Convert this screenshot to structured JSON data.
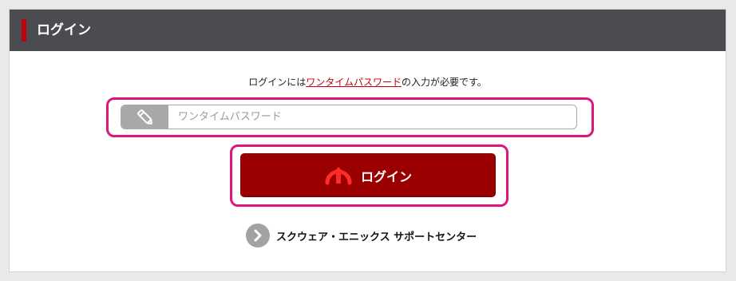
{
  "header": {
    "title": "ログイン"
  },
  "notice": {
    "before": "ログインには",
    "link": "ワンタイムパスワード",
    "after": "の入力が必要です。"
  },
  "otp_input": {
    "placeholder": "ワンタイムパスワード",
    "value": "",
    "icon": "pencil-icon"
  },
  "login_button": {
    "label": "ログイン",
    "icon": "login-arrow-icon"
  },
  "support": {
    "label": "スクウェア・エニックス サポートセンター",
    "icon": "chevron-right-icon"
  },
  "colors": {
    "header_bg": "#4a4c52",
    "accent_red": "#c4000b",
    "button_red": "#9a0000",
    "highlight_pink": "#e0157a"
  }
}
